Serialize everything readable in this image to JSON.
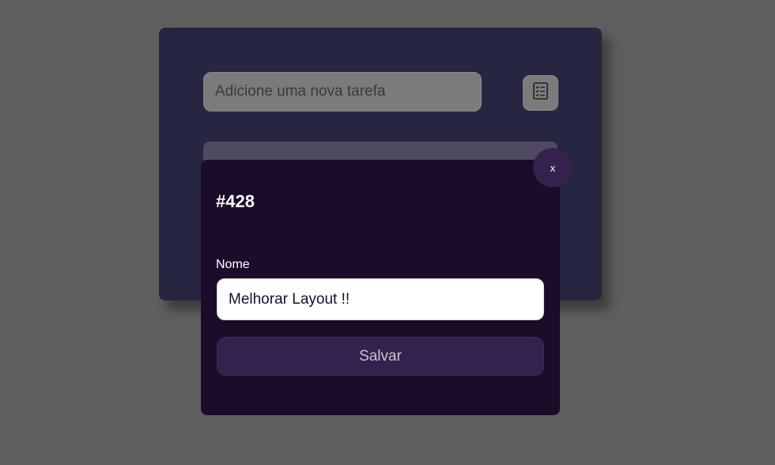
{
  "task_form": {
    "input_placeholder": "Adicione uma nova tarefa",
    "add_icon": "checklist-icon"
  },
  "modal": {
    "title": "#428",
    "close_label": "x",
    "name_label": "Nome",
    "name_value": "Melhorar Layout !!",
    "save_label": "Salvar"
  },
  "colors": {
    "page_background": "#5e5e5e",
    "card_background": "#262640",
    "modal_background": "#1b0c2a",
    "accent": "#35214e"
  }
}
